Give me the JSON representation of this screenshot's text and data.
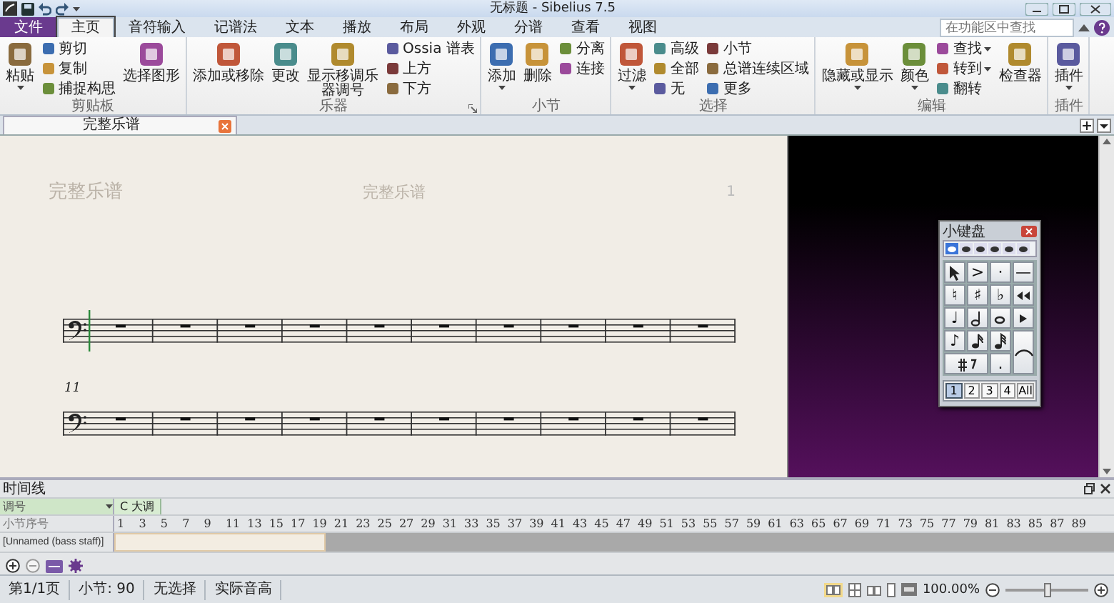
{
  "window": {
    "title": "无标题 - Sibelius 7.5"
  },
  "ribbon_tabs": [
    {
      "label": "文件",
      "kind": "file",
      "selected": false
    },
    {
      "label": "主页",
      "kind": "tab",
      "selected": true
    },
    {
      "label": "音符输入",
      "kind": "tab",
      "selected": false
    },
    {
      "label": "记谱法",
      "kind": "tab",
      "selected": false
    },
    {
      "label": "文本",
      "kind": "tab",
      "selected": false
    },
    {
      "label": "播放",
      "kind": "tab",
      "selected": false
    },
    {
      "label": "布局",
      "kind": "tab",
      "selected": false
    },
    {
      "label": "外观",
      "kind": "tab",
      "selected": false
    },
    {
      "label": "分谱",
      "kind": "tab",
      "selected": false
    },
    {
      "label": "查看",
      "kind": "tab",
      "selected": false
    },
    {
      "label": "视图",
      "kind": "tab",
      "selected": false
    }
  ],
  "ribbon_search": {
    "placeholder": "在功能区中查找"
  },
  "ribbon_groups": [
    {
      "label": "剪贴板",
      "launcher": false,
      "columns": [
        {
          "kind": "large",
          "items": [
            {
              "label": "粘贴",
              "menu": true
            }
          ]
        },
        {
          "kind": "stack",
          "items": [
            {
              "label": "剪切",
              "menu": false
            },
            {
              "label": "复制",
              "menu": false
            },
            {
              "label": "捕捉构思",
              "menu": false
            }
          ]
        },
        {
          "kind": "large",
          "items": [
            {
              "label": "选择图形",
              "menu": false
            }
          ]
        }
      ]
    },
    {
      "label": "乐器",
      "launcher": true,
      "columns": [
        {
          "kind": "large",
          "items": [
            {
              "label": "添加或移除",
              "menu": false
            }
          ]
        },
        {
          "kind": "large",
          "items": [
            {
              "label": "更改",
              "menu": false
            }
          ]
        },
        {
          "kind": "large",
          "items": [
            {
              "label": "显示移调乐器调号",
              "menu": false
            }
          ]
        },
        {
          "kind": "stack",
          "items": [
            {
              "label": "Ossia 谱表",
              "menu": false
            },
            {
              "label": "上方",
              "menu": false
            },
            {
              "label": "下方",
              "menu": false
            }
          ]
        }
      ]
    },
    {
      "label": "小节",
      "launcher": false,
      "columns": [
        {
          "kind": "large",
          "items": [
            {
              "label": "添加",
              "menu": true
            }
          ]
        },
        {
          "kind": "large",
          "items": [
            {
              "label": "删除",
              "menu": false
            }
          ]
        },
        {
          "kind": "stack",
          "items": [
            {
              "label": "分离",
              "menu": false
            },
            {
              "label": "连接",
              "menu": false
            }
          ]
        }
      ]
    },
    {
      "label": "选择",
      "launcher": false,
      "columns": [
        {
          "kind": "large",
          "items": [
            {
              "label": "过滤",
              "menu": true
            }
          ]
        },
        {
          "kind": "stack",
          "items": [
            {
              "label": "高级",
              "menu": false
            },
            {
              "label": "全部",
              "menu": false
            },
            {
              "label": "无",
              "menu": false
            }
          ]
        },
        {
          "kind": "stack",
          "items": [
            {
              "label": "小节",
              "menu": false
            },
            {
              "label": "总谱连续区域",
              "menu": false
            },
            {
              "label": "更多",
              "menu": false
            }
          ]
        }
      ]
    },
    {
      "label": "编辑",
      "launcher": false,
      "columns": [
        {
          "kind": "large",
          "items": [
            {
              "label": "隐藏或显示",
              "menu": true
            }
          ]
        },
        {
          "kind": "large",
          "items": [
            {
              "label": "颜色",
              "menu": true
            }
          ]
        },
        {
          "kind": "stack",
          "items": [
            {
              "label": "查找",
              "menu": true
            },
            {
              "label": "转到",
              "menu": true
            },
            {
              "label": "翻转",
              "menu": false
            }
          ]
        },
        {
          "kind": "large",
          "items": [
            {
              "label": "检查器",
              "menu": false
            }
          ]
        }
      ]
    },
    {
      "label": "插件",
      "launcher": false,
      "columns": [
        {
          "kind": "large",
          "items": [
            {
              "label": "插件",
              "menu": true
            }
          ]
        }
      ]
    }
  ],
  "document_tabs": [
    {
      "label": "完整乐谱",
      "selected": true
    }
  ],
  "score": {
    "header_left": "完整乐谱",
    "header_center": "完整乐谱",
    "page_number": "1",
    "measure_number": "11"
  },
  "keypad": {
    "title": "小键盘",
    "tabs": [
      {
        "selected": true
      },
      {
        "selected": false
      },
      {
        "selected": false
      },
      {
        "selected": false
      },
      {
        "selected": false
      },
      {
        "selected": false
      }
    ],
    "keys": [
      {
        "kind": "icon"
      },
      {
        "kind": "text",
        "label": ">"
      },
      {
        "kind": "text",
        "label": "·"
      },
      {
        "kind": "text",
        "label": "—"
      },
      {
        "kind": "text",
        "label": "♮"
      },
      {
        "kind": "text",
        "label": "♯"
      },
      {
        "kind": "text",
        "label": "♭"
      },
      {
        "kind": "icon"
      },
      {
        "kind": "text",
        "label": "♩"
      },
      {
        "kind": "icon"
      },
      {
        "kind": "icon"
      },
      {
        "kind": "icon"
      },
      {
        "kind": "text",
        "label": "♪"
      },
      {
        "kind": "icon"
      },
      {
        "kind": "icon"
      },
      {
        "kind": "icon"
      },
      {
        "kind": "icon"
      },
      {
        "kind": "text",
        "label": "."
      }
    ],
    "layouts": [
      {
        "label": "1",
        "selected": true
      },
      {
        "label": "2",
        "selected": false
      },
      {
        "label": "3",
        "selected": false
      },
      {
        "label": "4",
        "selected": false
      },
      {
        "label": "All",
        "selected": false
      }
    ]
  },
  "timeline": {
    "title": "时间线",
    "rows": [
      {
        "kind": "key",
        "label": "调号",
        "value": "C 大调"
      },
      {
        "kind": "numbers",
        "label": "小节序号",
        "values": [
          "1",
          "3",
          "5",
          "7",
          "9",
          "11",
          "13",
          "15",
          "17",
          "19",
          "21",
          "23",
          "25",
          "27",
          "29",
          "31",
          "33",
          "35",
          "37",
          "39",
          "41",
          "43",
          "45",
          "47",
          "49",
          "51",
          "53",
          "55",
          "57",
          "59",
          "61",
          "63",
          "65",
          "67",
          "69",
          "71",
          "73",
          "75",
          "77",
          "79",
          "81",
          "83",
          "85",
          "87",
          "89"
        ]
      },
      {
        "kind": "staff",
        "label": "[Unnamed (bass staff)]"
      }
    ]
  },
  "status_bar": {
    "items": [
      "第1/1页",
      "小节: 90",
      "无选择",
      "实际音高"
    ],
    "zoom": "100.00%",
    "zoom_slider": {
      "level": 0.5
    }
  }
}
